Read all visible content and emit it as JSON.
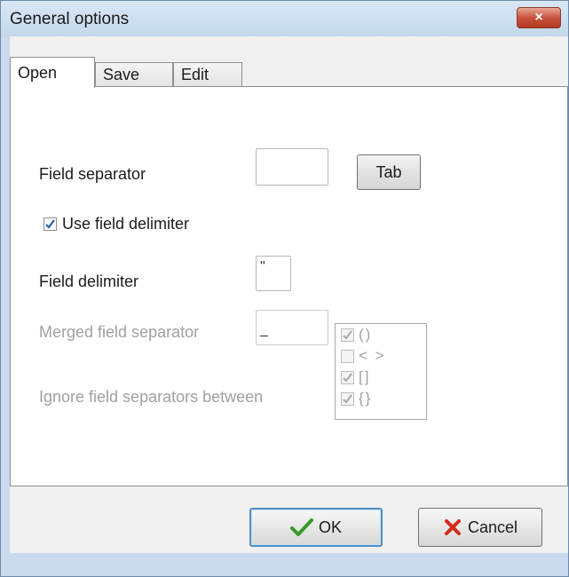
{
  "window": {
    "title": "General options",
    "close_label": "×"
  },
  "tabs": [
    {
      "label": "Open",
      "active": true
    },
    {
      "label": "Save",
      "active": false
    },
    {
      "label": "Edit",
      "active": false
    }
  ],
  "open_panel": {
    "field_separator": {
      "label": "Field separator",
      "value": "",
      "button_label": "Tab"
    },
    "use_field_delimiter": {
      "label": "Use field delimiter",
      "checked": true
    },
    "field_delimiter": {
      "label": "Field delimiter",
      "value": "\""
    },
    "merged_field_separator": {
      "label": "Merged field separator",
      "value": "_",
      "enabled": false
    },
    "ignore_between": {
      "label": "Ignore field separators between",
      "enabled": false,
      "items": [
        {
          "text": "()",
          "checked": true
        },
        {
          "text": "< >",
          "checked": false
        },
        {
          "text": "[]",
          "checked": true
        },
        {
          "text": "{}",
          "checked": true
        }
      ]
    }
  },
  "footer": {
    "ok_label": "OK",
    "cancel_label": "Cancel"
  },
  "colors": {
    "ok_check": "#3a9a2a",
    "cancel_x": "#d42a1a",
    "close_button": "#c9523d"
  }
}
